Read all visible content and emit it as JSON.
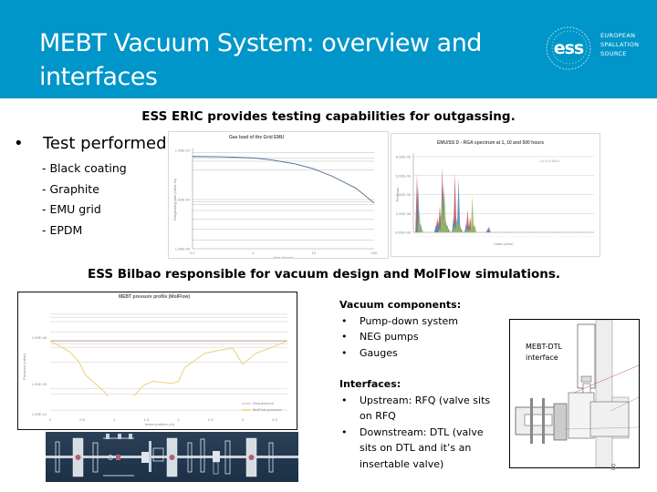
{
  "header": {
    "title": "MEBT Vacuum System: overview and interfaces",
    "logo": {
      "icon": "ess-logo-icon",
      "mark": "ess",
      "lines": [
        "EUROPEAN",
        "SPALLATION",
        "SOURCE"
      ]
    },
    "background_color": "#0096c9"
  },
  "section1": {
    "heading": "ESS ERIC provides testing capabilities for outgassing.",
    "bullet": "•",
    "bullet_text": "Test performed:",
    "tests": [
      "- Black coating",
      "- Graphite",
      "- EMU grid",
      "- EPDM"
    ]
  },
  "section2": {
    "heading": "ESS Bilbao responsible for vacuum design and MolFlow simulations."
  },
  "chart_data": [
    {
      "type": "line",
      "title": "Gas load of the Grid EMU",
      "xlabel": "time (hours)",
      "ylabel": "Outgassing rate (mbar l/s)",
      "x_scale": "log",
      "y_scale": "log",
      "x_ticks": [
        "0.1",
        "1",
        "10",
        "100"
      ],
      "y_ticks": [
        "1.00E-03",
        "1.00E-04",
        "1.00E-05"
      ],
      "series": [
        {
          "name": "Grid EMU",
          "color": "#4a6a8a",
          "x": [
            0.1,
            0.3,
            1,
            2,
            5,
            10,
            20,
            50,
            100
          ],
          "y": [
            0.00075,
            0.00074,
            0.0007,
            0.00064,
            0.00053,
            0.00042,
            0.0003,
            0.00017,
            8.5e-05
          ]
        }
      ],
      "grid": true
    },
    {
      "type": "bar",
      "title": "EMU/SS D - RGA spectrum at 1, 10 and 500 hours",
      "xlabel": "mass (amu)",
      "ylabel": "Pressure",
      "legend": "top-right",
      "y_ticks": [
        "1.00E-05",
        "8.00E-06",
        "6.00E-06",
        "4.00E-06",
        "2.00E-06",
        "0.00E+00"
      ],
      "series": [
        {
          "name": "1 h",
          "color": "#c0504d",
          "values": [
            0.78,
            0.1,
            0,
            0,
            0,
            0,
            0,
            0,
            0.2,
            0.35,
            0.87,
            0.25,
            0.1,
            0,
            0,
            0.78,
            0.1,
            0.1,
            0,
            0,
            0.3,
            0.2,
            0.15,
            0,
            0,
            0,
            0,
            0,
            0.05,
            0
          ]
        },
        {
          "name": "10 h",
          "color": "#4f81bd",
          "values": [
            0.6,
            0.12,
            0,
            0,
            0,
            0,
            0,
            0.1,
            0.15,
            0.25,
            0.65,
            0.15,
            0.05,
            0,
            0.2,
            0.2,
            0.72,
            0.05,
            0,
            0.12,
            0.1,
            0.05,
            0.1,
            0,
            0,
            0,
            0,
            0,
            0.08,
            0
          ]
        },
        {
          "name": "500 h",
          "color": "#9bbb59",
          "values": [
            0.3,
            0.05,
            0,
            0,
            0,
            0,
            0,
            0,
            0.05,
            0.5,
            0.55,
            0.1,
            0.02,
            0,
            0.1,
            0.2,
            0.12,
            0.02,
            0,
            0.05,
            0.05,
            0.48,
            0.1,
            0,
            0,
            0,
            0,
            0,
            0,
            0
          ]
        }
      ],
      "y_unit_max": 1.0,
      "grid": true
    },
    {
      "type": "line",
      "title": "MEBT pressure profile (MolFlow)",
      "xlabel": "beam position (m)",
      "ylabel": "Pressure (mbar)",
      "x_ticks": [
        "0",
        "0.5",
        "1",
        "1.5",
        "2",
        "2.5",
        "3",
        "3.5"
      ],
      "series": [
        {
          "name": "Requirement",
          "color": "#c09a9a",
          "x": [
            0,
            3.7
          ],
          "y": [
            0.7,
            0.7
          ]
        },
        {
          "name": "MolFlow pressure",
          "color": "#e8d27a",
          "x": [
            0,
            0.3,
            0.45,
            0.55,
            0.7,
            0.85,
            0.9,
            null,
            1.3,
            1.45,
            1.6,
            1.9,
            2.0,
            2.1,
            2.4,
            2.7,
            2.85,
            3.0,
            3.2,
            3.5,
            3.7
          ],
          "y": [
            0.7,
            0.6,
            0.5,
            0.38,
            0.3,
            0.22,
            0.18,
            null,
            0.18,
            0.28,
            0.32,
            0.3,
            0.32,
            0.45,
            0.58,
            0.62,
            0.63,
            0.48,
            0.58,
            0.65,
            0.7
          ]
        }
      ],
      "legend": "bottom-right",
      "grid": true
    }
  ],
  "right_panel": {
    "components_heading": "Vacuum components:",
    "components": [
      "Pump-down system",
      "NEG pumps",
      "Gauges"
    ],
    "interfaces_heading": "Interfaces:",
    "interfaces": [
      "Upstream: RFQ (valve sits on RFQ",
      "Downstream: DTL (valve sits on DTL and it’s an insertable valve)"
    ],
    "bullet": "•"
  },
  "interface_figure": {
    "label_line1": "MEBT-DTL",
    "label_line2": "interface"
  },
  "page_number": "8"
}
